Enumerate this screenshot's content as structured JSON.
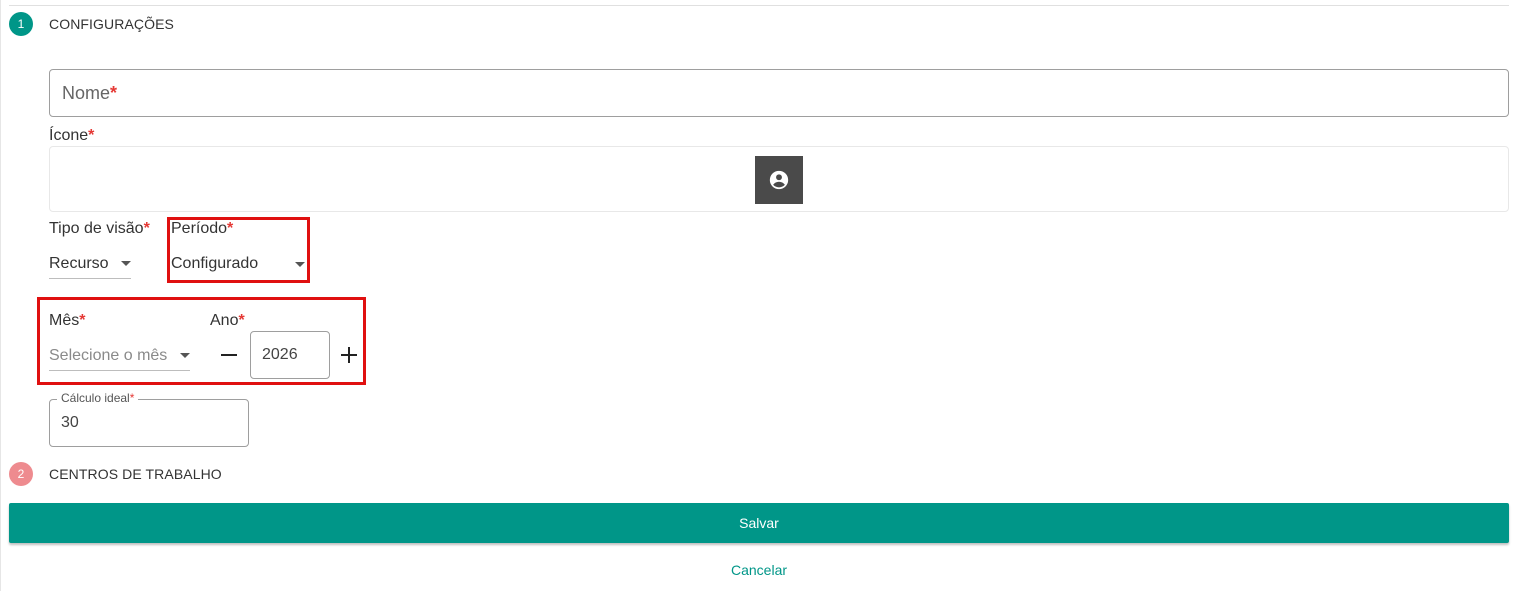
{
  "steps": [
    {
      "number": "1",
      "title": "CONFIGURAÇÕES"
    },
    {
      "number": "2",
      "title": "CENTROS DE TRABALHO"
    }
  ],
  "form": {
    "name": {
      "placeholder": "Nome",
      "required_mark": "*"
    },
    "icon": {
      "label": "Ícone",
      "required_mark": "*",
      "selected_icon": "account-circle-icon"
    },
    "tipo_visao": {
      "label": "Tipo de visão",
      "required_mark": "*",
      "value": "Recurso"
    },
    "periodo": {
      "label": "Período",
      "required_mark": "*",
      "value": "Configurado"
    },
    "mes": {
      "label": "Mês",
      "required_mark": "*",
      "placeholder": "Selecione o mês"
    },
    "ano": {
      "label": "Ano",
      "required_mark": "*",
      "value": "2026"
    },
    "calculo_ideal": {
      "label": "Cálculo ideal",
      "required_mark": "*",
      "value": "30"
    }
  },
  "actions": {
    "save_label": "Salvar",
    "cancel_label": "Cancelar"
  },
  "colors": {
    "primary": "#009688",
    "step_inactive": "#ee8b8f",
    "required": "#e53935",
    "highlight": "#e01010",
    "icon_button": "#4a4a4a"
  }
}
